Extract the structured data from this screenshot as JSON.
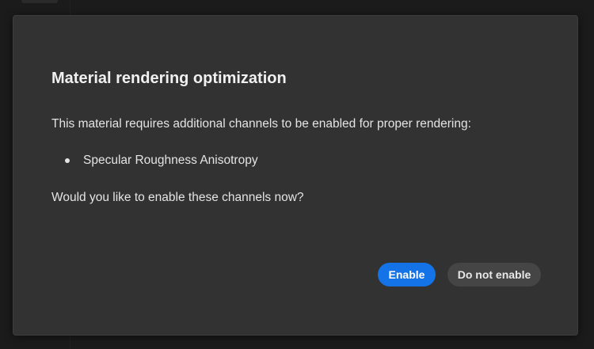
{
  "dialog": {
    "title": "Material rendering optimization",
    "message": "This material requires additional channels to be enabled for proper rendering:",
    "channels": [
      "Specular Roughness Anisotropy"
    ],
    "question": "Would you like to enable these channels now?",
    "enable_label": "Enable",
    "do_not_enable_label": "Do not enable"
  },
  "colors": {
    "primary_button": "#1473e6",
    "secondary_button": "#454545",
    "dialog_background": "#323232",
    "page_background": "#1b1b1b"
  }
}
